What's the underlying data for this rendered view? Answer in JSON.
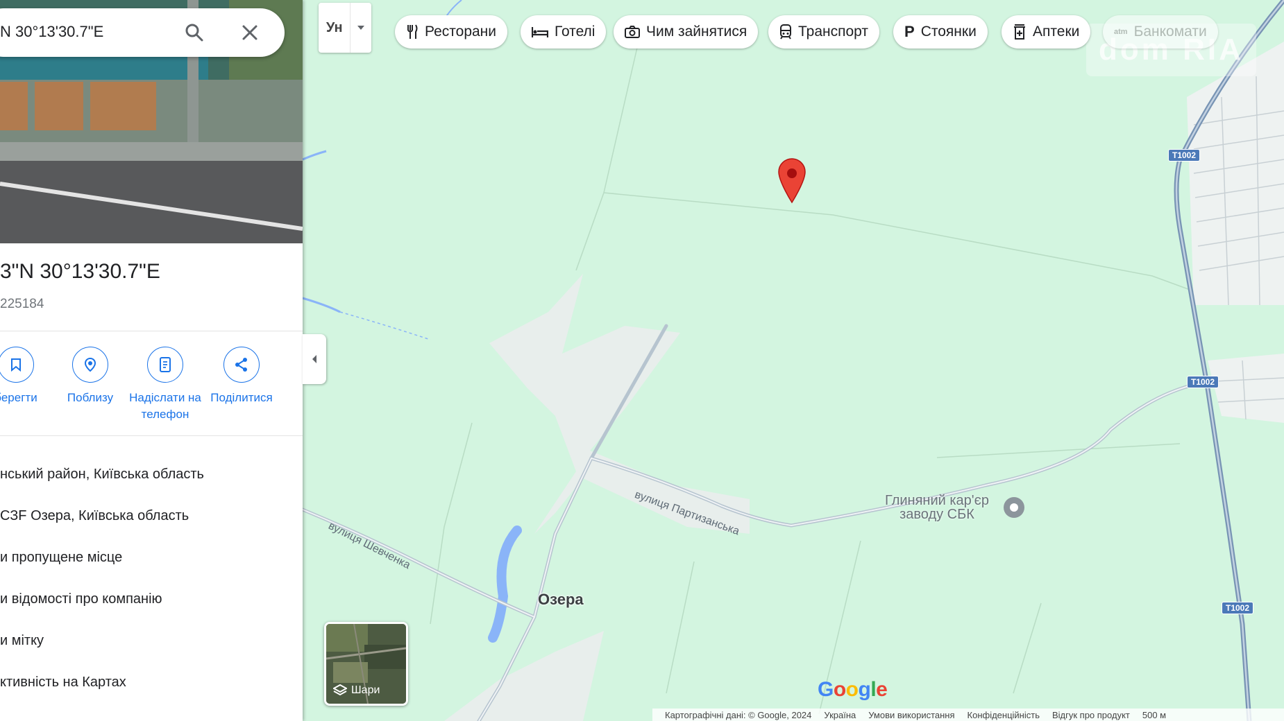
{
  "search": {
    "value": "N 30°13'30.7\"E"
  },
  "place": {
    "title": "3\"N 30°13'30.7\"E",
    "plus_code": "225184"
  },
  "actions": [
    {
      "label": "берегти",
      "icon": "bookmark-icon"
    },
    {
      "label": "Поблизу",
      "icon": "nearby-icon"
    },
    {
      "label": "Надіслати на телефон",
      "icon": "send-to-phone-icon"
    },
    {
      "label": "Поділитися",
      "icon": "share-icon"
    }
  ],
  "info_rows": [
    "нський район, Київська область",
    "СЗF Озера, Київська область",
    "и пропущене місце",
    "и відомості про компанію",
    "и мітку",
    "ктивність на Картах"
  ],
  "lang_button": "Ун",
  "chips": [
    {
      "label": "Ресторани",
      "icon": "restaurant-icon"
    },
    {
      "label": "Готелі",
      "icon": "hotel-icon"
    },
    {
      "label": "Чим зайнятися",
      "icon": "camera-icon"
    },
    {
      "label": "Транспорт",
      "icon": "transit-icon"
    },
    {
      "label": "Стоянки",
      "icon": "parking-icon"
    },
    {
      "label": "Аптеки",
      "icon": "pharmacy-icon"
    },
    {
      "label": "Банкомати",
      "icon": "atm-icon"
    }
  ],
  "map_labels": {
    "street_1": "вулиця Партизанська",
    "street_2": "вулиця Шевченка",
    "village": "Озера",
    "poi_line1": "Глиняний кар'єр",
    "poi_line2": "заводу СБК",
    "road_shield": "T1002"
  },
  "watermark": "dom RIA",
  "layers_label": "Шари",
  "google_logo": "Google",
  "footer": [
    "Картографічні дані: © Google, 2024",
    "Україна",
    "Умови використання",
    "Конфіденційність",
    "Відгук про продукт",
    "500 м"
  ],
  "colors": {
    "map_bg": "#d3f5e0",
    "accent": "#1a73e8",
    "pin": "#ea4335",
    "road": "#a8b8c8",
    "highway": "#7894b4",
    "water": "#8ab4f8"
  }
}
